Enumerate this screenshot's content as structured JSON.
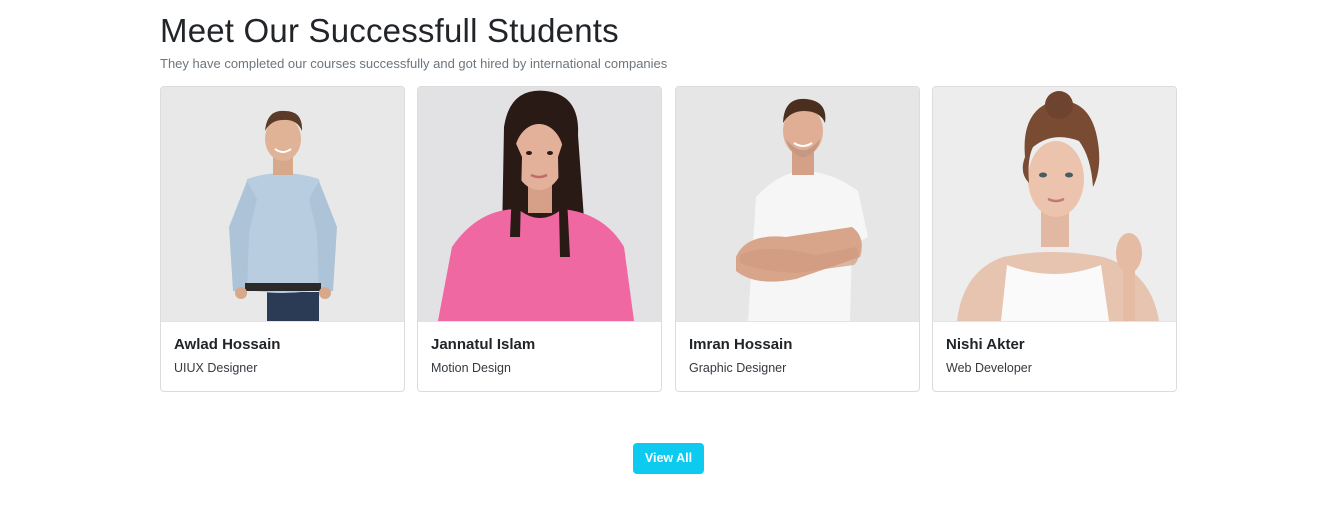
{
  "section": {
    "title": "Meet Our Successfull Students",
    "subtitle": "They have completed our courses successfully and got hired by international companies"
  },
  "students": [
    {
      "name": "Awlad Hossain",
      "role": "UIUX Designer",
      "photo_desc": "man-light-blue-shirt"
    },
    {
      "name": "Jannatul Islam",
      "role": "Motion Design",
      "photo_desc": "woman-pink-sweater"
    },
    {
      "name": "Imran Hossain",
      "role": "Graphic Designer",
      "photo_desc": "man-white-tshirt-arms-crossed"
    },
    {
      "name": "Nishi Akter",
      "role": "Web Developer",
      "photo_desc": "woman-white-top"
    }
  ],
  "view_all": {
    "label": "View All"
  },
  "colors": {
    "accent": "#0dcaf0",
    "title": "#212529",
    "subtitle": "#6c757d",
    "card_border": "#dcdcdc"
  }
}
